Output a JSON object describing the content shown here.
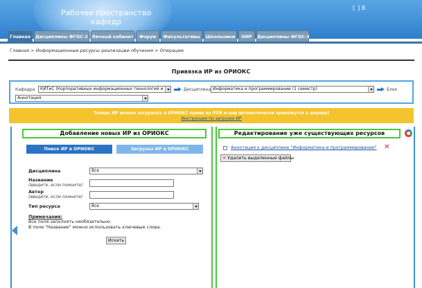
{
  "header": {
    "title_line1": "Рабочее пространство",
    "title_line2": "кафедр",
    "login_open": "[",
    "login_link": "",
    "login_close": "] В"
  },
  "nav": {
    "tabs": [
      "Главная",
      "Дисциплины ФГОС-2",
      "Личный кабинет",
      "Форум",
      "Факультативы",
      "Школьники",
      "НИР",
      "Дисциплины ФГОС-3"
    ],
    "active_index": 0
  },
  "breadcrumb": "Главная > Информационные ресурсы реализации обучения > Операции",
  "page_title": "Привязка ИР из ОРИОКС",
  "selection": {
    "kafedra_label": "Кафедра",
    "kafedra_value": "КИТиС (Корпоративных информационных технологий и с...",
    "discipline_label": "Дисциплина",
    "discipline_value": "Информатика и программирование (1 семестр)",
    "block_label": "Блок",
    "block_value": "Аннотация"
  },
  "notice": {
    "text": "Теперь ИР можно загружать в ОРИОКС прямо из РПК и они автоматически привяжутся к дереву!",
    "link": "Инструкция по загрузке ИР"
  },
  "left": {
    "heading": "Добавление новых ИР из ОРИОКС",
    "tab_search": "Поиск ИР в ОРИОКС",
    "tab_upload": "Загрузка ИР в ОРИОКС",
    "discipline_label": "Дисциплина",
    "discipline_value": "Все",
    "name_label": "Название",
    "name_hint": "(введите, если помните)",
    "author_label": "Автор",
    "author_hint": "(введите, если помните)",
    "type_label": "Тип ресурса",
    "type_value": "Все",
    "notes_title": "Примечания:",
    "note1": "Все поля заполнять необязательно.",
    "note2": "В поле \"Название\" можно использовать ключевые слова.",
    "search_button": "Искать"
  },
  "right": {
    "heading": "Редактирование уже существующих ресурсов",
    "resource_link": "Аннотация к дисциплине \"Информатика и программирование\"",
    "delete_button": "Удалить выделенные файлы",
    "delete_mark": "✕",
    "delete_x": "✕"
  },
  "colors": {
    "header_blue": "#2f7fcc",
    "tab_gray": "#7c9cb7",
    "notice_yellow": "#f3c42e",
    "green_border": "#46c93a",
    "button_blue": "#2b73c5",
    "button_light_blue": "#7fb6ea"
  }
}
